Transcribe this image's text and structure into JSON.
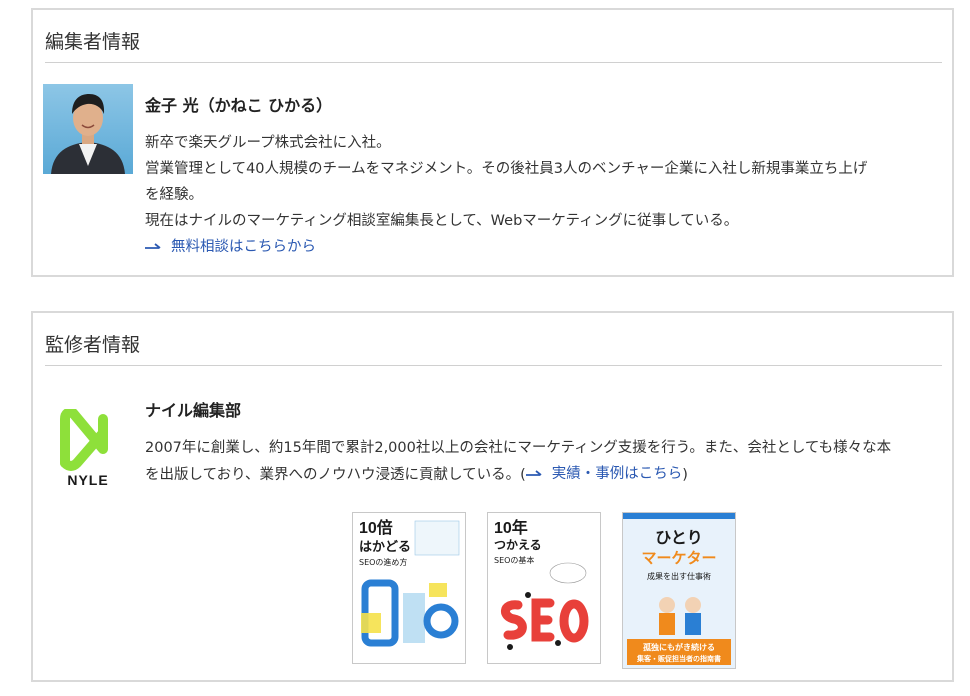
{
  "editor": {
    "section_title": "編集者情報",
    "name": "金子 光（かねこ ひかる）",
    "bio": [
      "新卒で楽天グループ株式会社に入社。",
      "営業管理として40人規模のチームをマネジメント。その後社員3人のベンチャー企業に入社し新規事業立ち上げ",
      "を経験。",
      "現在はナイルのマーケティング相談室編集長として、Webマーケティングに従事している。"
    ],
    "link_label": "無料相談はこちらから"
  },
  "supervisor": {
    "section_title": "監修者情報",
    "logo_text": "NYLE",
    "name": "ナイル編集部",
    "description_line1": "2007年に創業し、約15年間で累計2,000社以上の会社にマーケティング支援を行う。また、会社としても様々な本",
    "description_line2_prefix": "を出版しており、業界へのノウハウ浸透に貢献している。(",
    "link_label": "実績・事例はこちら",
    "description_line2_suffix": ")",
    "books": [
      {
        "title_line1": "10倍",
        "title_line2": "はかどる",
        "title_line3": "SEOの進め方",
        "cover_art": "SEO"
      },
      {
        "title_line1": "10年",
        "title_line2": "つかえる",
        "title_line3": "SEOの基本",
        "cover_art": "SEO"
      },
      {
        "title_line1": "ひとり",
        "title_line2": "マーケター",
        "title_line3": "成果を出す仕事術",
        "banner_line1": "孤独にもがき続ける",
        "banner_line2": "集客・販促担当者の指南書"
      }
    ]
  },
  "colors": {
    "panel_border": "#d9d9d9",
    "link": "#2b59b2",
    "nyle_green": "#8ee03a",
    "book_orange": "#f08a1c",
    "book_red": "#e8403a",
    "book_blue": "#2a7fd4"
  }
}
